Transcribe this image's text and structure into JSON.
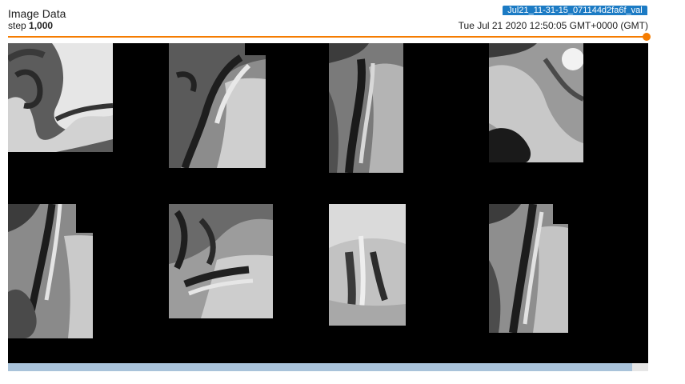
{
  "card": {
    "title": "Image Data",
    "step_label": "step",
    "step_value": "1,000",
    "run_name": "Jul21_11-31-15_071144d2fa6f_val",
    "timestamp": "Tue Jul 21 2020 12:50:05 GMT+0000 (GMT)"
  },
  "slider": {
    "value_fraction": 1.0
  },
  "colors": {
    "accent": "#f57c00",
    "run_badge": "#1c7bc4",
    "canvas_bg": "#000000",
    "scrollbar_thumb": "#a9c3da"
  },
  "images": [
    {
      "name": "mri-slice-1"
    },
    {
      "name": "mri-slice-2"
    },
    {
      "name": "mri-slice-3"
    },
    {
      "name": "mri-slice-4"
    },
    {
      "name": "mri-slice-5"
    },
    {
      "name": "mri-slice-6"
    },
    {
      "name": "mri-slice-7"
    },
    {
      "name": "mri-slice-8"
    }
  ]
}
